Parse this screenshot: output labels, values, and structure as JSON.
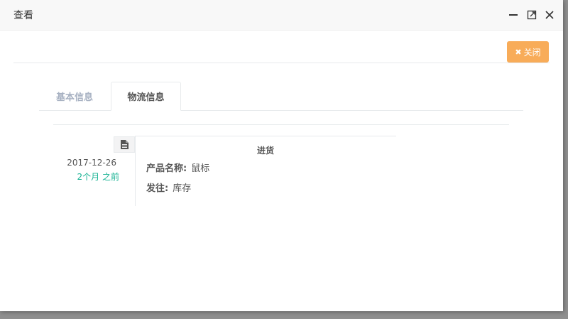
{
  "window": {
    "title": "查看",
    "controls": {
      "minimize_icon": "minimize-icon",
      "maximize_icon": "maximize-icon",
      "close_icon": "close-icon"
    }
  },
  "toolbar": {
    "close_label": "关闭",
    "close_icon": "times-icon",
    "close_color": "#f8ac59"
  },
  "tabs": [
    {
      "label": "基本信息",
      "active": false
    },
    {
      "label": "物流信息",
      "active": true
    }
  ],
  "timeline": {
    "icon": "file-text-icon",
    "date": "2017-12-26",
    "relative": "2个月 之前",
    "relative_color": "#1ab394",
    "heading": "进货",
    "fields": [
      {
        "label": "产品名称:",
        "value": "鼠标"
      },
      {
        "label": "发往:",
        "value": "库存"
      }
    ]
  }
}
